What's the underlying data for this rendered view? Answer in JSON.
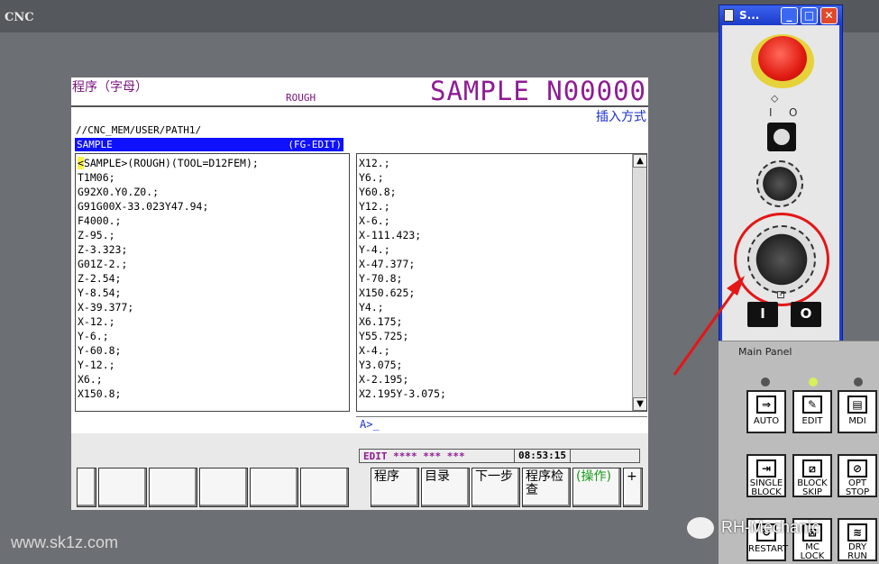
{
  "window": {
    "title": "CNC"
  },
  "screen": {
    "prog_type": "程序（字母）",
    "rough": "ROUGH",
    "prog_name": "SAMPLE N00000",
    "insert_mode": "插入方式",
    "path": "//CNC_MEM/USER/PATH1/",
    "file_name": "SAMPLE",
    "edit_mode": "(FG-EDIT)",
    "left_lines": [
      "<SAMPLE>(ROUGH)(TOOL=D12FEM);",
      "T1M06;",
      "G92X0.Y0.Z0.;",
      "G91G00X-33.023Y47.94;",
      "F4000.;",
      "Z-95.;",
      "Z-3.323;",
      "G01Z-2.;",
      "Z-2.54;",
      "Y-8.54;",
      "X-39.377;",
      "X-12.;",
      "Y-6.;",
      "Y-60.8;",
      "Y-12.;",
      "X6.;",
      "X150.8;"
    ],
    "right_lines": [
      "X12.;",
      "Y6.;",
      "Y60.8;",
      "Y12.;",
      "X-6.;",
      "X-111.423;",
      "Y-4.;",
      "X-47.377;",
      "Y-70.8;",
      "X150.625;",
      "Y4.;",
      "X6.175;",
      "Y55.725;",
      "X-4.;",
      "Y3.075;",
      "X-2.195;",
      "X2.195Y-3.075;"
    ],
    "input_prompt": "A>_",
    "status_mode": "EDIT **** *** ***",
    "clock": "08:53:15",
    "softkeys": [
      "程序",
      "目录",
      "下一步",
      "程序检查",
      "(操作)",
      "+"
    ]
  },
  "side_panel": {
    "title": "S...",
    "btn_min": "_",
    "btn_max": "□",
    "btn_close": "✕",
    "label_i": "I",
    "label_o": "O",
    "btn_off": "I",
    "btn_on": "O"
  },
  "main_panel": {
    "label": "Main Panel",
    "keys": [
      {
        "label": "AUTO",
        "icon": "⇒"
      },
      {
        "label": "EDIT",
        "icon": "✎"
      },
      {
        "label": "MDI",
        "icon": "▤"
      },
      {
        "label": "SINGLE BLOCK",
        "icon": "⇥"
      },
      {
        "label": "BLOCK SKIP",
        "icon": "⧄"
      },
      {
        "label": "OPT STOP",
        "icon": "⊘"
      },
      {
        "label": "RESTART",
        "icon": "↻"
      },
      {
        "label": "MC LOCK",
        "icon": "⊠"
      },
      {
        "label": "DRY RUN",
        "icon": "≋"
      }
    ]
  },
  "watermarks": {
    "left": "www.sk1z.com",
    "right": "RH-Mechanic"
  },
  "colors": {
    "annotation": "#e41616",
    "prog_name": "#8f1b94",
    "file_bar": "#0f10ff"
  }
}
